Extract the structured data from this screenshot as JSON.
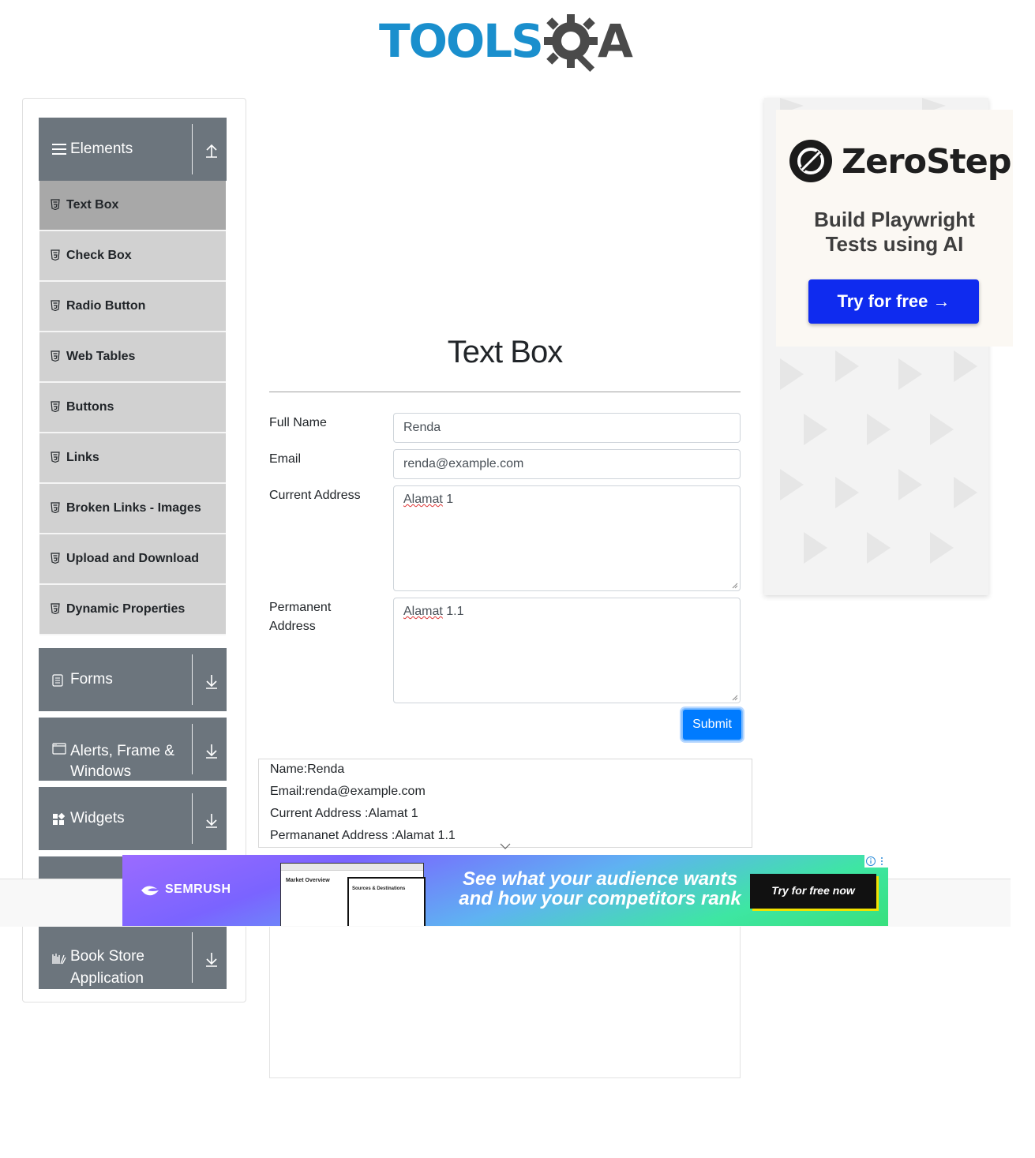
{
  "logo": {
    "part1": "TOOLS",
    "part2": "A"
  },
  "sidebar": {
    "elements_label": "Elements",
    "items": [
      {
        "label": "Text Box"
      },
      {
        "label": "Check Box"
      },
      {
        "label": "Radio Button"
      },
      {
        "label": "Web Tables"
      },
      {
        "label": "Buttons"
      },
      {
        "label": "Links"
      },
      {
        "label": "Broken Links - Images"
      },
      {
        "label": "Upload and Download"
      },
      {
        "label": "Dynamic Properties"
      }
    ],
    "groups": [
      {
        "label": "Forms"
      },
      {
        "label": "Alerts, Frame &",
        "label2": "Windows"
      },
      {
        "label": "Widgets"
      },
      {
        "label": "Book Store",
        "label2": "Application"
      }
    ]
  },
  "main": {
    "title": "Text Box",
    "form": {
      "full_name_label": "Full Name",
      "full_name_value": "Renda",
      "email_label": "Email",
      "email_value": "renda@example.com",
      "current_address_label": "Current Address",
      "current_address_word": "Alamat",
      "current_address_rest": " 1",
      "permanent_address_label_1": "Permanent",
      "permanent_address_label_2": "Address",
      "permanent_address_word": "Alamat",
      "permanent_address_rest": " 1.1",
      "submit_label": "Submit"
    },
    "output": {
      "name": "Name:Renda",
      "email": "Email:renda@example.com",
      "current": "Current Address :Alamat 1",
      "permanent": "Permananet Address :Alamat 1.1"
    }
  },
  "ad_right": {
    "brand": "ZeroStep",
    "tagline_1": "Build Playwright",
    "tagline_2": "Tests using AI",
    "button": "Try for free →"
  },
  "ad_bottom": {
    "brand": "SEMRUSH",
    "screenshot_title_1": "Market Overview",
    "screenshot_title_2": "Sources & Destinations",
    "headline_1": "See what your audience wants",
    "headline_2": "and how your competitors rank",
    "button": "Try for free now"
  },
  "colors": {
    "primary": "#007bff",
    "sidebar_header": "#6c757d",
    "menu_item": "#d1d1d1",
    "menu_item_active": "#a8a8a8",
    "logo_blue": "#1a8fcd",
    "zerostep_button": "#0f2bef"
  },
  "icons": {
    "elements": "hamburger-icon",
    "menu_item": "html5-shield-icon",
    "expanded": "arrow-up-icon",
    "collapsed": "arrow-down-icon",
    "forms": "document-icon",
    "alerts": "window-icon",
    "widgets": "widgets-icon",
    "book_store": "books-icon"
  }
}
